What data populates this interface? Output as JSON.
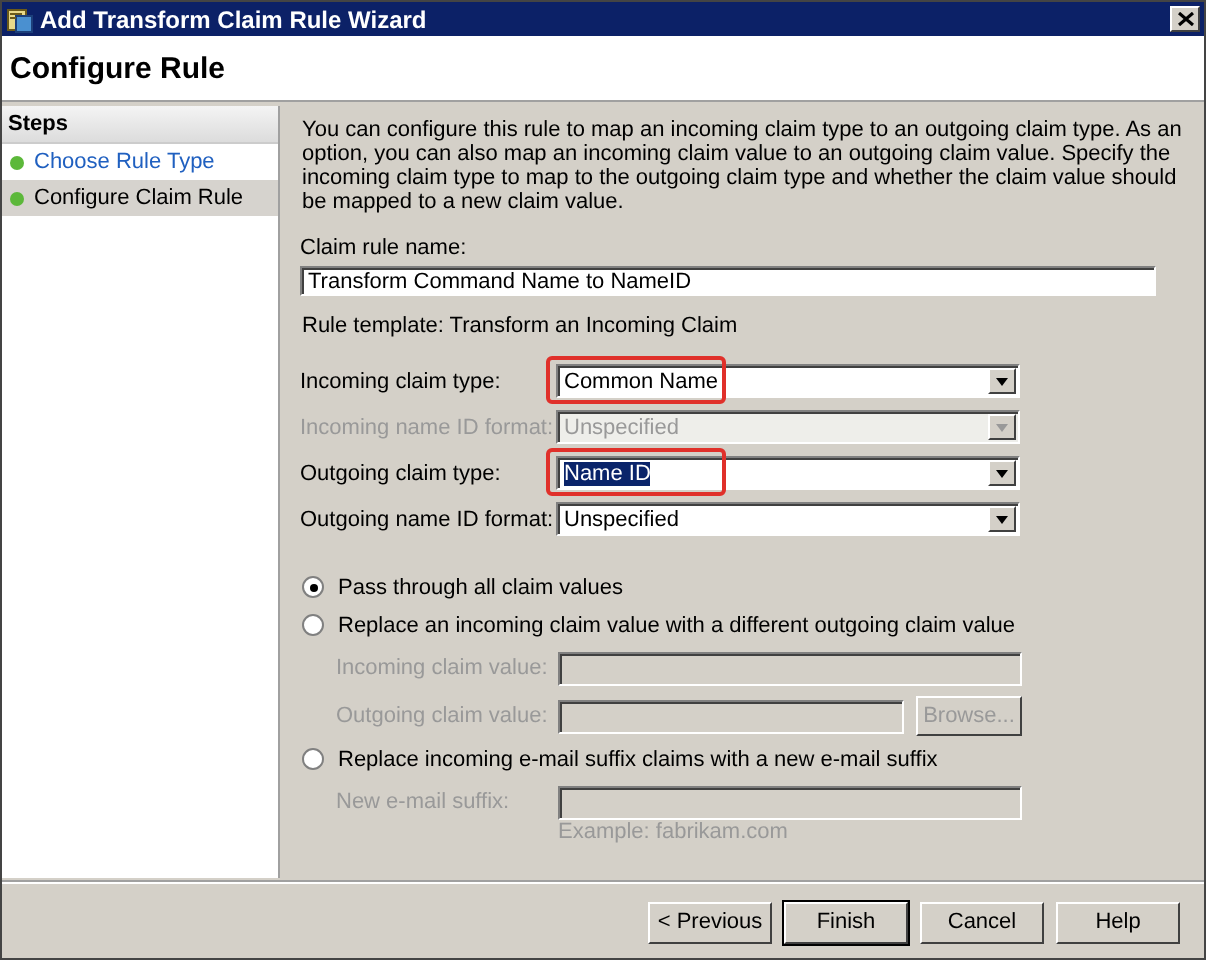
{
  "window": {
    "title": "Add Transform Claim Rule Wizard"
  },
  "page_title": "Configure Rule",
  "steps": {
    "heading": "Steps",
    "items": [
      {
        "label": "Choose Rule Type",
        "selected": false
      },
      {
        "label": "Configure Claim Rule",
        "selected": true
      }
    ]
  },
  "description": "You can configure this rule to map an incoming claim type to an outgoing claim type. As an option, you can also map an incoming claim value to an outgoing claim value. Specify the incoming claim type to map to the outgoing claim type and whether the claim value should be mapped to a new claim value.",
  "claim_rule_name": {
    "label": "Claim rule name:",
    "value": "Transform Command Name to NameID"
  },
  "rule_template": "Rule template: Transform an Incoming Claim",
  "claim_fields": [
    {
      "label": "Incoming claim type:",
      "value": "Common Name",
      "disabled": false,
      "highlighted": true,
      "text_selected": false
    },
    {
      "label": "Incoming name ID format:",
      "value": "Unspecified",
      "disabled": true,
      "highlighted": false,
      "text_selected": false
    },
    {
      "label": "Outgoing claim type:",
      "value": "Name ID",
      "disabled": false,
      "highlighted": true,
      "text_selected": true
    },
    {
      "label": "Outgoing name ID format:",
      "value": "Unspecified",
      "disabled": false,
      "highlighted": false,
      "text_selected": false
    }
  ],
  "options": [
    {
      "label": "Pass through all claim values",
      "selected": true
    },
    {
      "label": "Replace an incoming claim value with a different outgoing claim value",
      "selected": false,
      "fields": [
        {
          "label": "Incoming claim value:",
          "disabled": true
        },
        {
          "label": "Outgoing claim value:",
          "disabled": true,
          "button": "Browse..."
        }
      ]
    },
    {
      "label": "Replace incoming e-mail suffix claims with a new e-mail suffix",
      "selected": false,
      "fields": [
        {
          "label": "New e-mail suffix:",
          "disabled": true,
          "hint": "Example: fabrikam.com"
        }
      ]
    }
  ],
  "buttons": [
    {
      "label": "< Previous",
      "default": false
    },
    {
      "label": "Finish",
      "default": true
    },
    {
      "label": "Cancel",
      "default": false
    },
    {
      "label": "Help",
      "default": false
    }
  ]
}
